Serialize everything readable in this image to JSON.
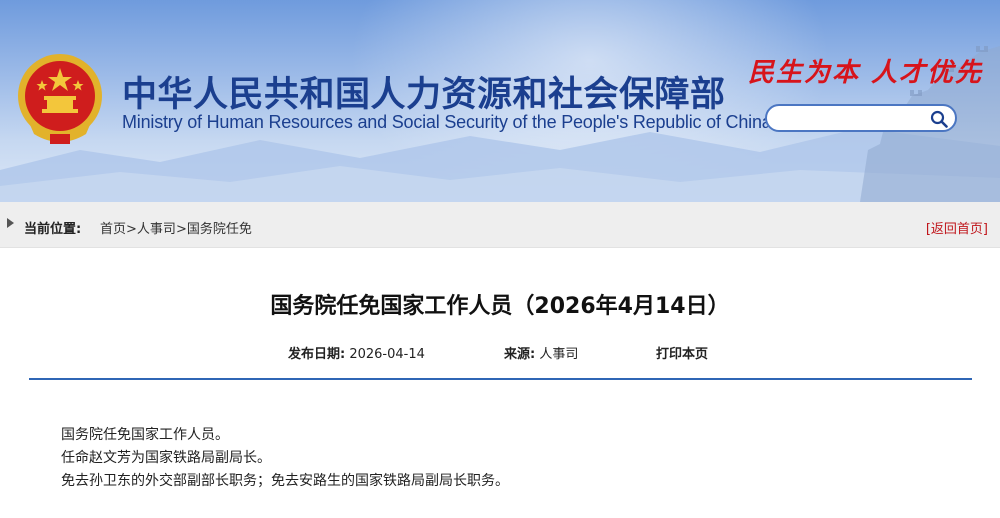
{
  "header": {
    "cn_title": "中华人民共和国人力资源和社会保障部",
    "en_title": "Ministry of Human Resources and Social Security of the People's Republic of China",
    "slogan": "民生为本  人才优先",
    "search": {
      "placeholder": "",
      "value": ""
    },
    "icons": {
      "emblem": "national-emblem",
      "search": "search-icon"
    }
  },
  "breadcrumb": {
    "label": "当前位置:",
    "items": [
      "首页",
      "人事司",
      "国务院任免"
    ],
    "separator": ">",
    "back_label": "[返回首页]"
  },
  "article": {
    "title": "国务院任免国家工作人员（2026年4月14日）",
    "meta": {
      "date_label": "发布日期:",
      "date_value": "2026-04-14",
      "source_label": "来源:",
      "source_value": "人事司",
      "print_label": "打印本页"
    },
    "paragraphs": [
      "国务院任免国家工作人员。",
      "任命赵文芳为国家铁路局副局长。",
      "免去孙卫东的外交部副部长职务；免去安路生的国家铁路局副局长职务。"
    ]
  },
  "colors": {
    "title_blue": "#1b3f8f",
    "slogan_red": "#d7141b",
    "rule_blue": "#2f66b5",
    "back_link_red": "#c0151b"
  }
}
